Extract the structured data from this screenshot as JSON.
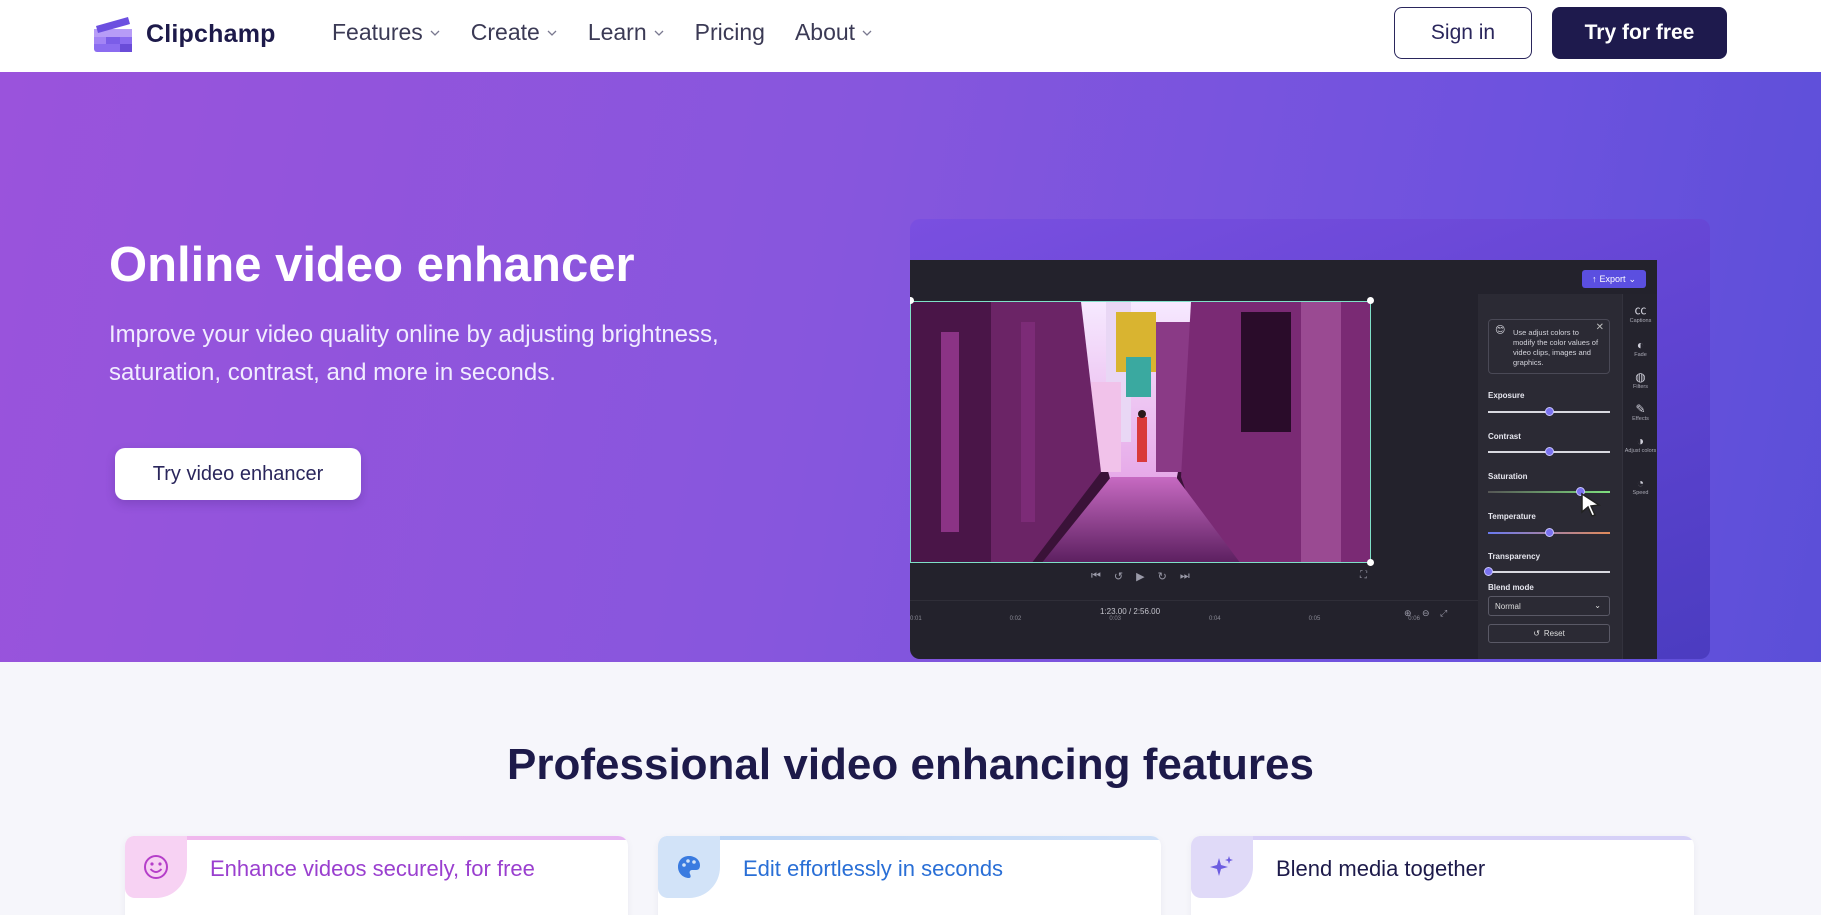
{
  "nav": {
    "brand": "Clipchamp",
    "items": [
      {
        "label": "Features",
        "has_dropdown": true
      },
      {
        "label": "Create",
        "has_dropdown": true
      },
      {
        "label": "Learn",
        "has_dropdown": true
      },
      {
        "label": "Pricing",
        "has_dropdown": false
      },
      {
        "label": "About",
        "has_dropdown": true
      }
    ],
    "signin_label": "Sign in",
    "try_label": "Try for free"
  },
  "hero": {
    "title": "Online video enhancer",
    "subtitle": "Improve your video quality online by adjusting brightness, saturation, contrast, and more in seconds.",
    "cta_label": "Try video enhancer"
  },
  "editor": {
    "export_label": "Export",
    "time_current": "1:23.00",
    "time_total": "/ 2:56.00",
    "timeline_ticks": [
      "0:01",
      "0:02",
      "0:03",
      "0:04",
      "0:05",
      "0:06"
    ],
    "tip_text": "Use adjust colors to modify the color values of video clips, images and graphics.",
    "sliders": [
      {
        "label": "Exposure",
        "value": 0.5
      },
      {
        "label": "Contrast",
        "value": 0.5
      },
      {
        "label": "Saturation",
        "value": 0.75
      },
      {
        "label": "Temperature",
        "value": 0.5
      },
      {
        "label": "Transparency",
        "value": 0.0
      }
    ],
    "blend_label": "Blend mode",
    "blend_value": "Normal",
    "reset_label": "Reset",
    "rail": [
      "Captions",
      "Fade",
      "Filters",
      "Effects",
      "Adjust colors",
      "Speed"
    ]
  },
  "features": {
    "title": "Professional video enhancing features",
    "cards": [
      {
        "label": "Enhance videos securely, for free",
        "color": "#9a3fcf",
        "icon": "smile-icon"
      },
      {
        "label": "Edit effortlessly in seconds",
        "color": "#2a6fd6",
        "icon": "palette-icon"
      },
      {
        "label": "Blend media together",
        "color": "#1d1a4a",
        "icon": "sparkles-icon"
      }
    ]
  }
}
